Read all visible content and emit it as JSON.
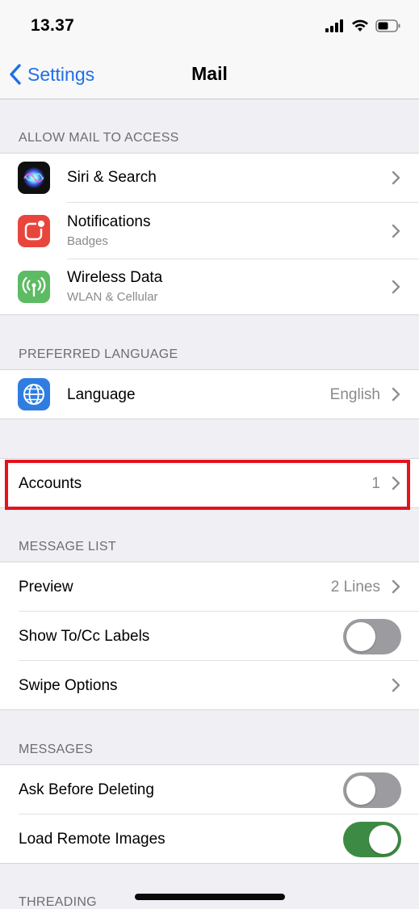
{
  "status_bar": {
    "time": "13.37"
  },
  "nav": {
    "back_label": "Settings",
    "title": "Mail"
  },
  "sections": {
    "allow_access": {
      "header": "ALLOW MAIL TO ACCESS",
      "items": [
        {
          "label": "Siri & Search",
          "icon": "siri-icon"
        },
        {
          "label": "Notifications",
          "sub": "Badges",
          "icon": "notifications-icon"
        },
        {
          "label": "Wireless Data",
          "sub": "WLAN & Cellular",
          "icon": "antenna-icon"
        }
      ]
    },
    "preferred_language": {
      "header": "PREFERRED LANGUAGE",
      "items": [
        {
          "label": "Language",
          "value": "English",
          "icon": "globe-icon"
        }
      ]
    },
    "accounts": {
      "items": [
        {
          "label": "Accounts",
          "value": "1"
        }
      ]
    },
    "message_list": {
      "header": "MESSAGE LIST",
      "items": [
        {
          "label": "Preview",
          "value": "2 Lines"
        },
        {
          "label": "Show To/Cc Labels",
          "toggle": false
        },
        {
          "label": "Swipe Options"
        }
      ]
    },
    "messages": {
      "header": "MESSAGES",
      "items": [
        {
          "label": "Ask Before Deleting",
          "toggle": false
        },
        {
          "label": "Load Remote Images",
          "toggle": true
        }
      ]
    },
    "threading": {
      "header": "THREADING"
    }
  },
  "colors": {
    "accent": "#1f6fe8",
    "toggle_on": "#3d8a45",
    "toggle_off": "#9b9ba0",
    "highlight": "#e4121c",
    "notifications_icon": "#e8463d",
    "wireless_icon": "#5dbb63",
    "language_icon": "#2f7de1"
  }
}
